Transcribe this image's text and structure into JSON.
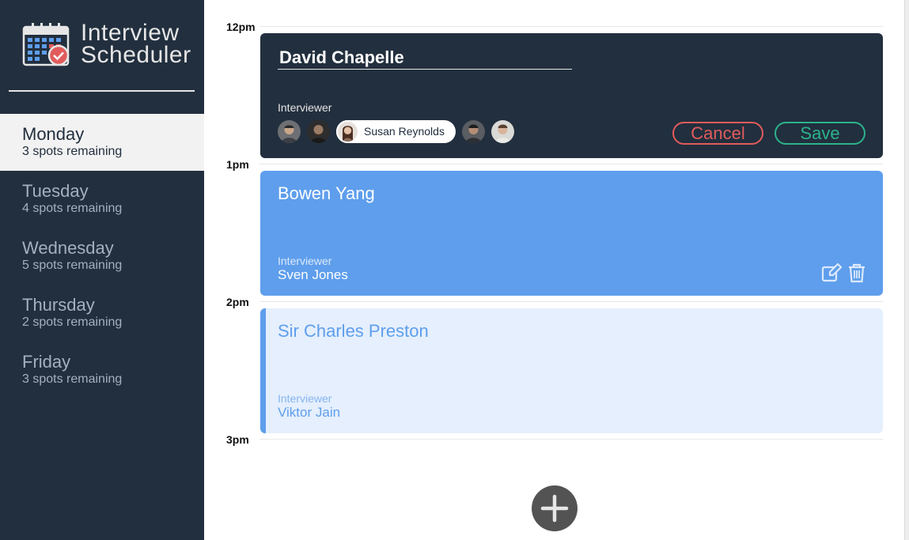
{
  "app": {
    "logo_line1": "Interview",
    "logo_line2": "Scheduler"
  },
  "sidebar": {
    "days": [
      {
        "name": "Monday",
        "spots": "3 spots remaining",
        "selected": true
      },
      {
        "name": "Tuesday",
        "spots": "4 spots remaining",
        "selected": false
      },
      {
        "name": "Wednesday",
        "spots": "5 spots remaining",
        "selected": false
      },
      {
        "name": "Thursday",
        "spots": "2 spots remaining",
        "selected": false
      },
      {
        "name": "Friday",
        "spots": "3 spots remaining",
        "selected": false
      }
    ]
  },
  "schedule": {
    "hours": [
      "12pm",
      "1pm",
      "2pm",
      "3pm"
    ],
    "form": {
      "student_value": "David Chapelle",
      "interviewer_label": "Interviewer",
      "selected_interviewer": "Susan Reynolds",
      "cancel_label": "Cancel",
      "save_label": "Save"
    },
    "booked": {
      "student": "Bowen Yang",
      "interviewer_label": "Interviewer",
      "interviewer": "Sven Jones",
      "edit_icon": "edit-icon",
      "delete_icon": "trash-icon"
    },
    "pending": {
      "student": "Sir Charles Preston",
      "interviewer_label": "Interviewer",
      "interviewer": "Viktor Jain"
    },
    "add_icon": "plus-icon"
  },
  "colors": {
    "sidebar_bg": "#222f3e",
    "accent_blue": "#5e9eec",
    "cancel_red": "#e15c5c",
    "save_green": "#2bb38c"
  }
}
